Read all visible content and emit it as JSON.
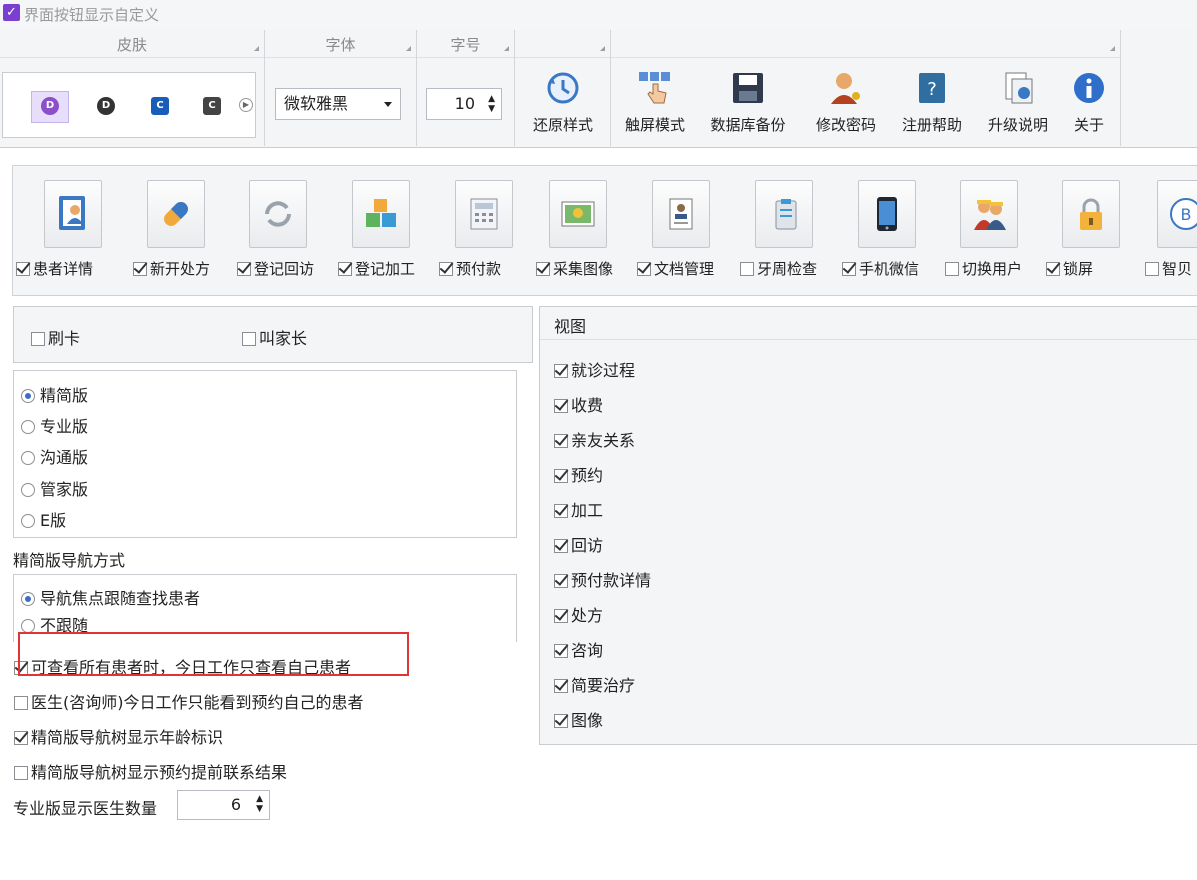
{
  "window": {
    "title": "界面按钮显示自定义"
  },
  "ribbon": {
    "skin_header": "皮肤",
    "font_header": "字体",
    "size_header": "字号",
    "font_value": "微软雅黑",
    "size_value": "10",
    "buttons": [
      {
        "label": "还原样式",
        "icon": "restore-icon"
      },
      {
        "label": "触屏模式",
        "icon": "touch-icon"
      },
      {
        "label": "数据库备份",
        "icon": "save-icon"
      },
      {
        "label": "修改密码",
        "icon": "user-key-icon"
      },
      {
        "label": "注册帮助",
        "icon": "help-book-icon"
      },
      {
        "label": "升级说明",
        "icon": "upgrade-doc-icon"
      },
      {
        "label": "关于",
        "icon": "info-icon"
      }
    ]
  },
  "toolbar": [
    {
      "label": "患者详情",
      "checked": true
    },
    {
      "label": "新开处方",
      "checked": true
    },
    {
      "label": "登记回访",
      "checked": true
    },
    {
      "label": "登记加工",
      "checked": true
    },
    {
      "label": "预付款",
      "checked": true
    },
    {
      "label": "采集图像",
      "checked": true
    },
    {
      "label": "文档管理",
      "checked": true
    },
    {
      "label": "牙周检查",
      "checked": false
    },
    {
      "label": "手机微信",
      "checked": true
    },
    {
      "label": "切换用户",
      "checked": false
    },
    {
      "label": "锁屏",
      "checked": true
    },
    {
      "label": "智贝",
      "checked": false
    }
  ],
  "options": {
    "swipe_card": "刷卡",
    "call_parent": "叫家长",
    "editions": [
      "精简版",
      "专业版",
      "沟通版",
      "管家版",
      "E版"
    ],
    "edition_selected": "精简版",
    "nav_mode_label": "精简版导航方式",
    "nav_modes": [
      "导航焦点跟随查找患者",
      "不跟随"
    ],
    "nav_selected": "导航焦点跟随查找患者",
    "check1": "可查看所有患者时，今日工作只查看自己患者",
    "check2": "医生(咨询师)今日工作只能看到预约自己的患者",
    "check3": "精简版导航树显示年龄标识",
    "check4": "精简版导航树显示预约提前联系结果",
    "doctor_count_label": "专业版显示医生数量",
    "doctor_count": "6"
  },
  "view": {
    "header": "视图",
    "items": [
      "就诊过程",
      "收费",
      "亲友关系",
      "预约",
      "加工",
      "回访",
      "预付款详情",
      "处方",
      "咨询",
      "简要治疗",
      "图像"
    ]
  },
  "colors": {
    "accent": "#7a3fd1",
    "highlight": "#e23434",
    "radio": "#3a6fc4"
  }
}
